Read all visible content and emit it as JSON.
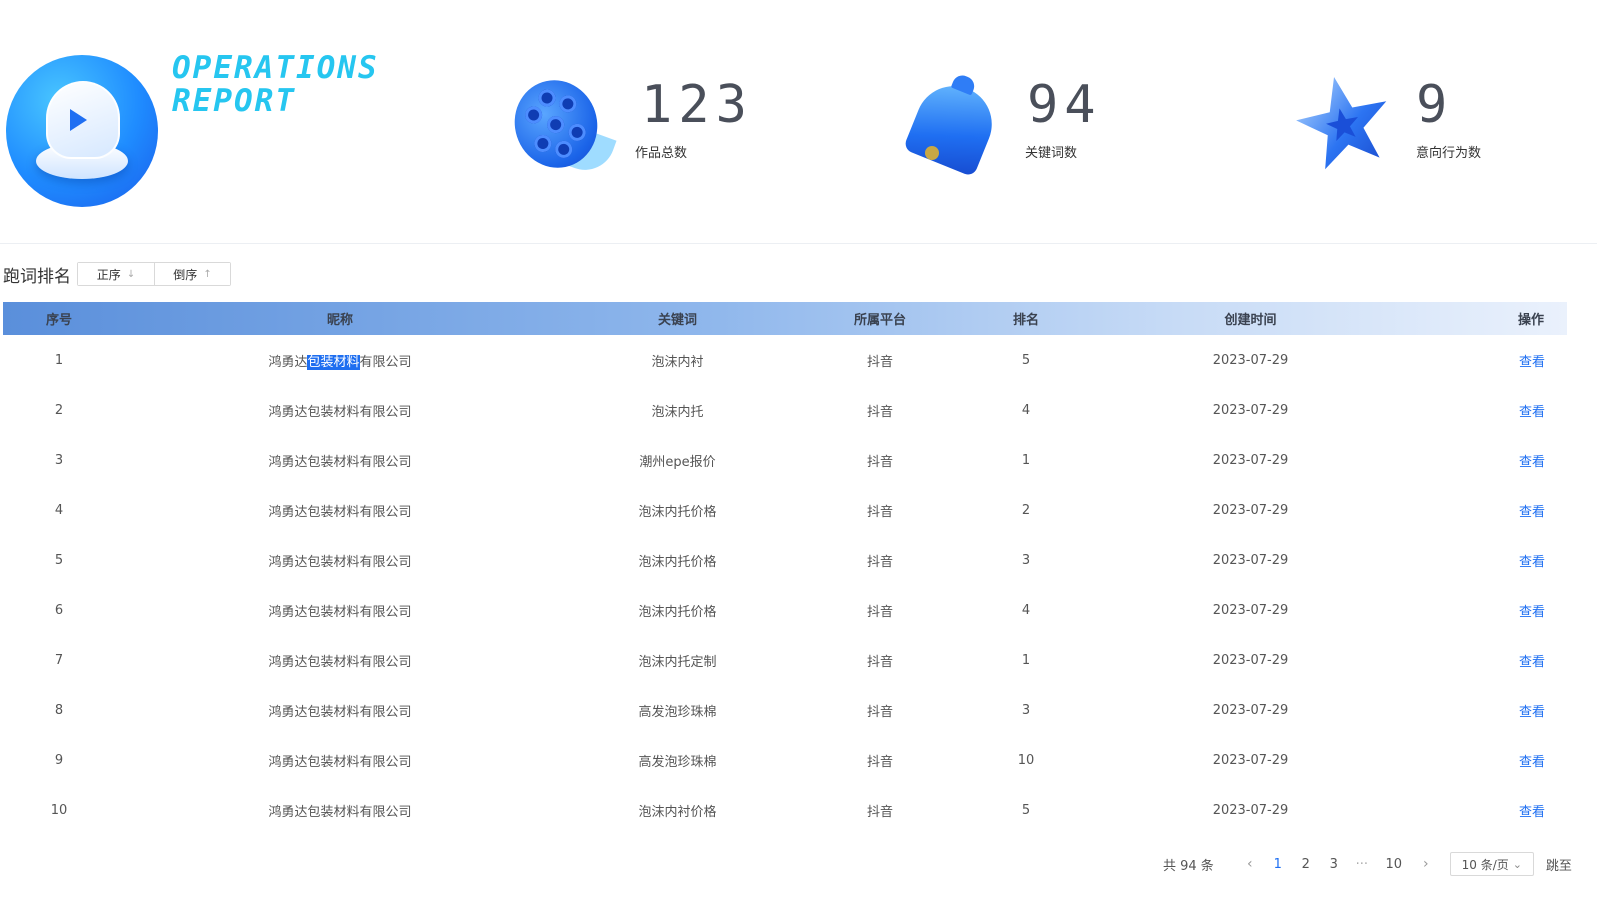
{
  "header": {
    "title_lines": [
      "OPERATIONS",
      "REPORT"
    ],
    "stats": [
      {
        "value": "123",
        "label": "作品总数",
        "icon": "film-reel-icon"
      },
      {
        "value": "94",
        "label": "关键词数",
        "icon": "bell-icon"
      },
      {
        "value": "9",
        "label": "意向行为数",
        "icon": "star-icon"
      }
    ]
  },
  "ranking": {
    "title": "跑词排名",
    "sort_asc": "正序",
    "sort_desc": "倒序",
    "sort_asc_arrow": "↓",
    "sort_desc_arrow": "↑"
  },
  "table": {
    "columns": [
      "序号",
      "昵称",
      "关键词",
      "所属平台",
      "排名",
      "创建时间",
      "操作"
    ],
    "rows": [
      {
        "idx": "1",
        "name_pre": "鸿勇达",
        "name_hl": "包装材料",
        "name_post": "有限公司",
        "keyword": "泡沫内衬",
        "platform": "抖音",
        "rank": "5",
        "date": "2023-07-29",
        "action": "查看"
      },
      {
        "idx": "2",
        "name": "鸿勇达包装材料有限公司",
        "keyword": "泡沫内托",
        "platform": "抖音",
        "rank": "4",
        "date": "2023-07-29",
        "action": "查看"
      },
      {
        "idx": "3",
        "name": "鸿勇达包装材料有限公司",
        "keyword": "潮州epe报价",
        "platform": "抖音",
        "rank": "1",
        "date": "2023-07-29",
        "action": "查看"
      },
      {
        "idx": "4",
        "name": "鸿勇达包装材料有限公司",
        "keyword": "泡沫内托价格",
        "platform": "抖音",
        "rank": "2",
        "date": "2023-07-29",
        "action": "查看"
      },
      {
        "idx": "5",
        "name": "鸿勇达包装材料有限公司",
        "keyword": "泡沫内托价格",
        "platform": "抖音",
        "rank": "3",
        "date": "2023-07-29",
        "action": "查看"
      },
      {
        "idx": "6",
        "name": "鸿勇达包装材料有限公司",
        "keyword": "泡沫内托价格",
        "platform": "抖音",
        "rank": "4",
        "date": "2023-07-29",
        "action": "查看"
      },
      {
        "idx": "7",
        "name": "鸿勇达包装材料有限公司",
        "keyword": "泡沫内托定制",
        "platform": "抖音",
        "rank": "1",
        "date": "2023-07-29",
        "action": "查看"
      },
      {
        "idx": "8",
        "name": "鸿勇达包装材料有限公司",
        "keyword": "高发泡珍珠棉",
        "platform": "抖音",
        "rank": "3",
        "date": "2023-07-29",
        "action": "查看"
      },
      {
        "idx": "9",
        "name": "鸿勇达包装材料有限公司",
        "keyword": "高发泡珍珠棉",
        "platform": "抖音",
        "rank": "10",
        "date": "2023-07-29",
        "action": "查看"
      },
      {
        "idx": "10",
        "name": "鸿勇达包装材料有限公司",
        "keyword": "泡沫内衬价格",
        "platform": "抖音",
        "rank": "5",
        "date": "2023-07-29",
        "action": "查看"
      }
    ]
  },
  "pagination": {
    "total": "共 94 条",
    "prev": "‹",
    "next": "›",
    "pages": [
      "1",
      "2",
      "3"
    ],
    "ellipsis": "···",
    "last": "10",
    "current": "1",
    "page_size": "10 条/页",
    "page_size_caret": "⌄",
    "jump_label": "跳至"
  },
  "colors": {
    "accent": "#1f6ff2",
    "title": "#26c6f0",
    "header_start": "#5a8fdb",
    "header_end": "#eaf1fc"
  }
}
